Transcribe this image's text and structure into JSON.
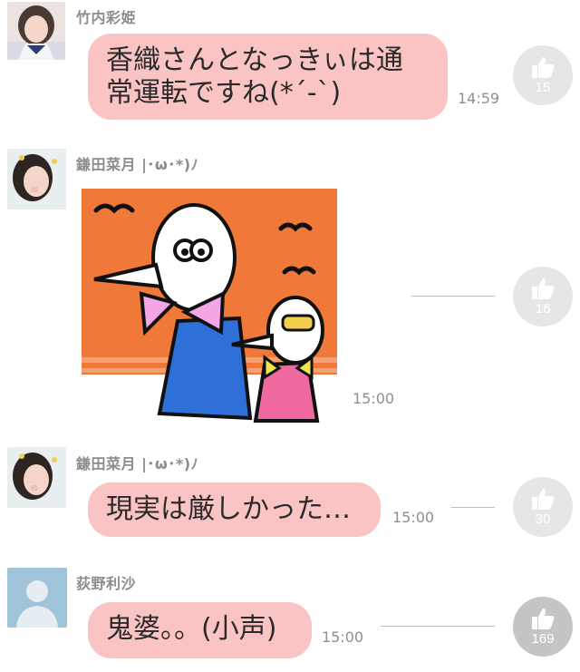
{
  "messages": [
    {
      "sender": "竹内彩姫",
      "text_line1": "香織さんとなっきぃは通",
      "text_line2": "常運転ですね(*´-`)",
      "time": "14:59",
      "likes": "15"
    },
    {
      "sender": "鎌田菜月 |･ω･*)ﾉ",
      "time": "15:00",
      "likes": "16",
      "sticker": "penguin-stickers"
    },
    {
      "sender": "鎌田菜月 |･ω･*)ﾉ",
      "text": "現実は厳しかった…",
      "time": "15:00",
      "likes": "30"
    },
    {
      "sender": "荻野利沙",
      "text": "鬼婆。。(小声)",
      "time": "15:00",
      "likes": "169"
    }
  ],
  "icons": {
    "like": "thumbs-up-icon"
  },
  "colors": {
    "bubble": "#fbc4c4",
    "like_circle": "#e6e6e6",
    "like_circle_active": "#c5c5c5",
    "sticker_sky": "#f07838"
  }
}
